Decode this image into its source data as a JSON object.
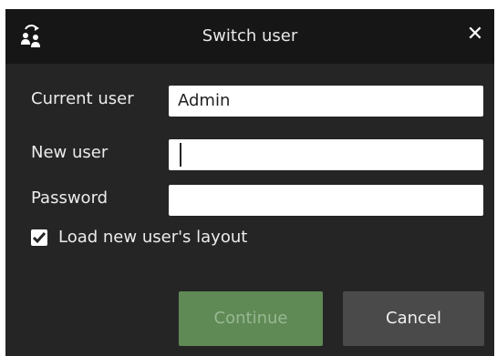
{
  "dialog": {
    "title": "Switch user",
    "title_icon": "switch-user-icon",
    "close_icon": "close-icon",
    "close_glyph": "✕"
  },
  "form": {
    "current_user_label": "Current user",
    "current_user_value": "Admin",
    "new_user_label": "New user",
    "new_user_value": "",
    "password_label": "Password",
    "password_value": "",
    "load_layout_label": "Load new user's layout",
    "load_layout_checked": true
  },
  "buttons": {
    "continue_label": "Continue",
    "cancel_label": "Cancel"
  },
  "colors": {
    "dialog_background": "#252525",
    "titlebar_background": "#161616",
    "continue_button": "#5f8a56",
    "cancel_button": "#4a4a4a"
  }
}
